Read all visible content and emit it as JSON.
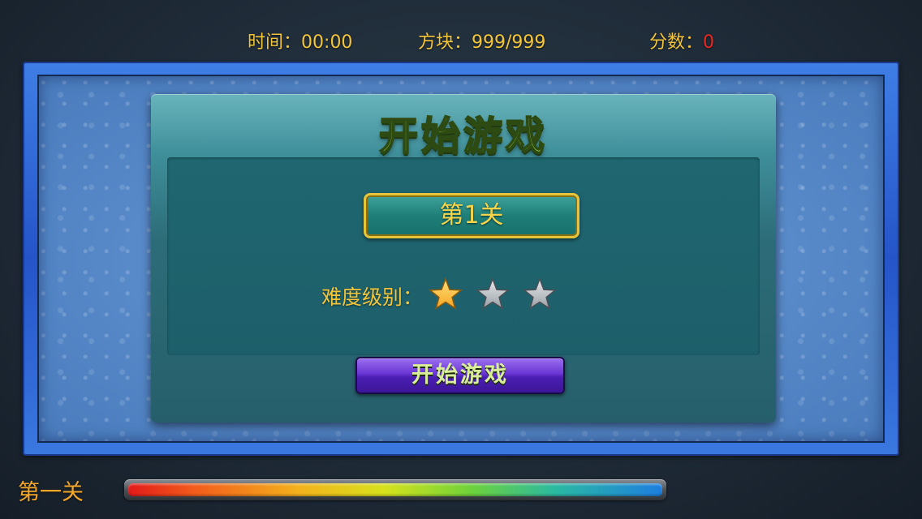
{
  "hud": {
    "time_label": "时间",
    "time_value": "00:00",
    "blocks_label": "方块",
    "blocks_value": "999/999",
    "score_label": "分数",
    "score_value": "0",
    "colon": "："
  },
  "dialog": {
    "title": "开始游戏",
    "level_button": "第1关",
    "difficulty_label": "难度级别：",
    "difficulty": {
      "filled": 1,
      "total": 3
    },
    "start_button": "开始游戏"
  },
  "footer": {
    "stage_label": "第一关",
    "progress": 1.0
  },
  "colors": {
    "hud_text": "#f2c53a",
    "score_value": "#e8281e",
    "star_filled": "#f5a623",
    "star_empty": "#9aa0a6"
  }
}
